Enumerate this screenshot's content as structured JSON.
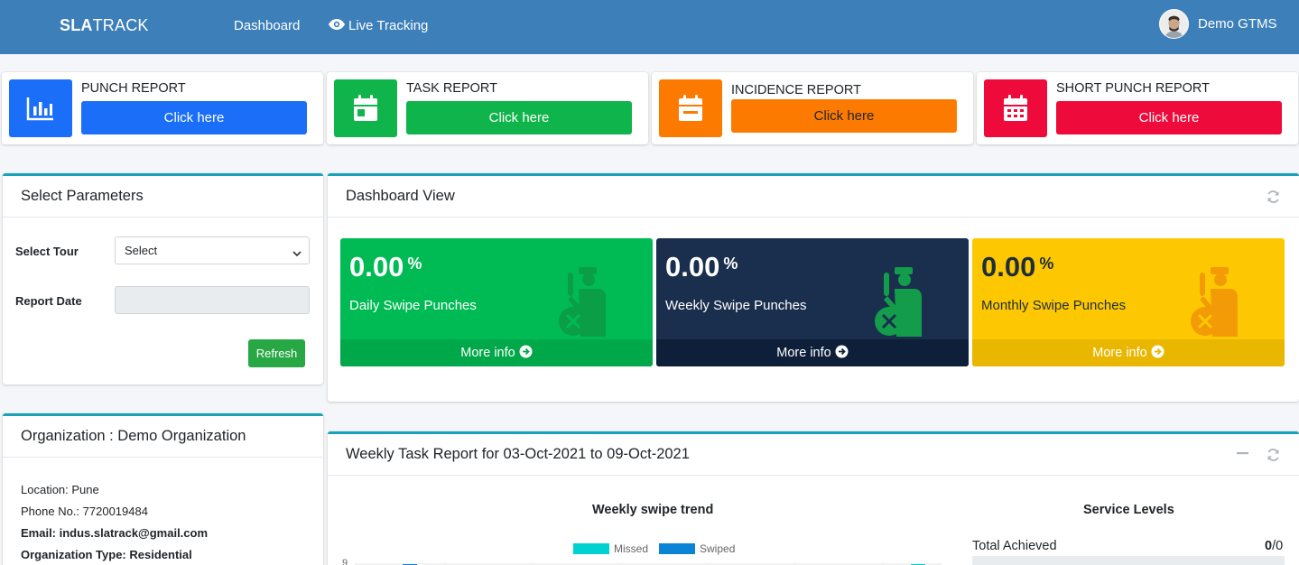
{
  "navbar": {
    "brand_bold": "SLA",
    "brand_rest": "TRACK",
    "links": [
      "Dashboard",
      "Live Tracking"
    ],
    "user_name": "Demo GTMS"
  },
  "reports": [
    {
      "title": "PUNCH REPORT",
      "button": "Click here",
      "color": "#1a6ef7",
      "icon": "bar-chart-icon"
    },
    {
      "title": "TASK REPORT",
      "button": "Click here",
      "color": "#0fb44a",
      "icon": "calendar-day-icon"
    },
    {
      "title": "INCIDENCE REPORT",
      "button": "Click here",
      "color": "#fd7a00",
      "icon": "calendar-minus-icon"
    },
    {
      "title": "SHORT PUNCH REPORT",
      "button": "Click here",
      "color": "#ee0a3a",
      "icon": "calendar-grid-icon"
    }
  ],
  "params": {
    "title": "Select Parameters",
    "tour_label": "Select Tour",
    "tour_value": "Select",
    "date_label": "Report Date",
    "refresh": "Refresh"
  },
  "dashboard": {
    "title": "Dashboard View",
    "stats": [
      {
        "value": "0.00",
        "unit": "%",
        "label": "Daily Swipe Punches",
        "more": "More info",
        "bg": "#00bb54",
        "foot": "#00a849",
        "fg": "#ffffff",
        "icon_fill": "#0a9e47"
      },
      {
        "value": "0.00",
        "unit": "%",
        "label": "Weekly Swipe Punches",
        "more": "More info",
        "bg": "#1a2e4e",
        "foot": "#0e1f3a",
        "fg": "#ffffff",
        "icon_fill": "#139d4a"
      },
      {
        "value": "0.00",
        "unit": "%",
        "label": "Monthly Swipe Punches",
        "more": "More info",
        "bg": "#fdc801",
        "foot": "#e9b700",
        "fg": "#1f2d3d",
        "icon_fill": "#f29b06"
      }
    ]
  },
  "org": {
    "title": "Organization : Demo Organization",
    "location": "Location: Pune",
    "phone": "Phone No.: 7720019484",
    "email": "Email: indus.slatrack@gmail.com",
    "type": "Organization Type: Residential"
  },
  "weekly": {
    "title": "Weekly Task Report for 03-Oct-2021 to 09-Oct-2021",
    "service_title": "Service Levels",
    "total_label": "Total Achieved",
    "total_value_bold": "0",
    "total_value_rest": "/0"
  },
  "chart_data": {
    "type": "bar",
    "title": "Weekly swipe trend",
    "series": [
      {
        "name": "Missed",
        "color": "#00d2d2"
      },
      {
        "name": "Swiped",
        "color": "#0a84d4"
      }
    ],
    "y_tick_visible": "9"
  }
}
